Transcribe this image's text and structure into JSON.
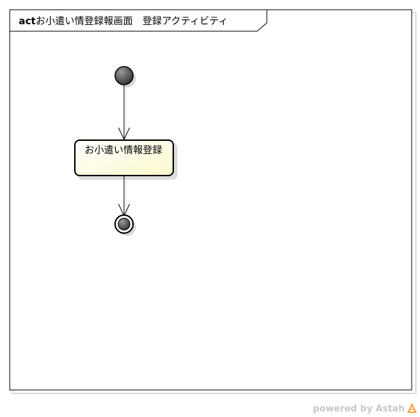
{
  "frame": {
    "keyword": "act",
    "title": "お小遣い情登録報画面　登録アクティビティ"
  },
  "nodes": {
    "initial": {
      "type": "initial-node"
    },
    "action": {
      "label": "お小遣い情報登録"
    },
    "final": {
      "type": "activity-final-node"
    }
  },
  "colors": {
    "action_fill": "#fffde0",
    "node_fill": "#555555",
    "watermark": "#c8c8c8",
    "logo": "#f0a040"
  },
  "watermark": {
    "text": "powered by Astah"
  }
}
